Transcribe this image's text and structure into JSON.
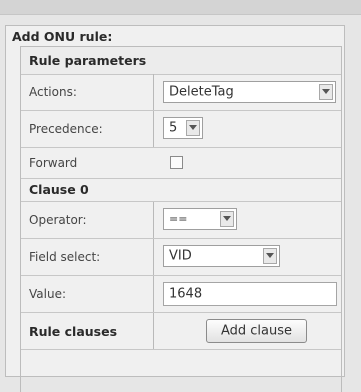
{
  "form": {
    "title": "Add ONU rule:",
    "section_title": "Rule parameters",
    "actions": {
      "label": "Actions:",
      "value": "DeleteTag"
    },
    "precedence": {
      "label": "Precedence:",
      "value": "5"
    },
    "forward": {
      "label": "Forward",
      "checked": false
    },
    "clause_title": "Clause 0",
    "operator": {
      "label": "Operator:",
      "value": "=="
    },
    "field_select": {
      "label": "Field select:",
      "value": "VID"
    },
    "value": {
      "label": "Value:",
      "value": "1648"
    },
    "rule_clauses": {
      "label": "Rule clauses",
      "button": "Add clause"
    }
  }
}
